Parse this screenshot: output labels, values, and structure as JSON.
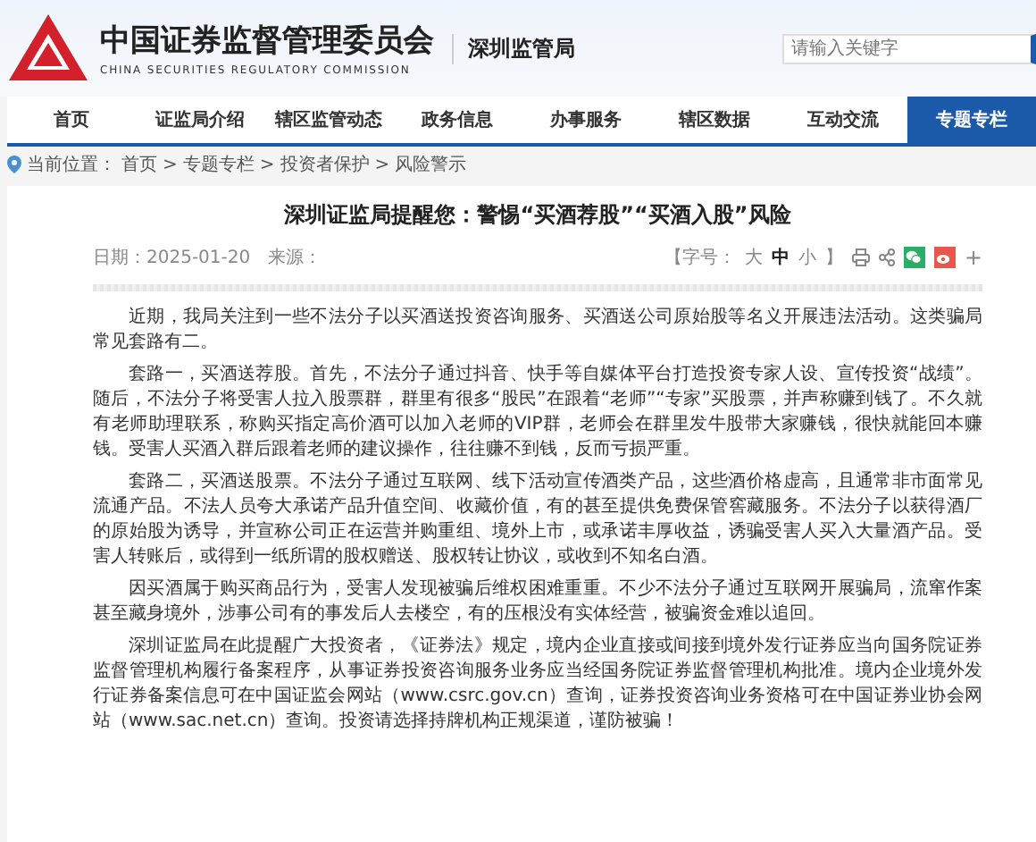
{
  "header": {
    "org_name": "中国证券监督管理委员会",
    "org_name_en": "CHINA SECURITIES REGULATORY COMMISSION",
    "bureau": "深圳监管局",
    "search": {
      "placeholder": "请输入关键字"
    }
  },
  "nav": [
    {
      "label": "首页",
      "selected": false
    },
    {
      "label": "证监局介绍",
      "selected": false
    },
    {
      "label": "辖区监管动态",
      "selected": false
    },
    {
      "label": "政务信息",
      "selected": false
    },
    {
      "label": "办事服务",
      "selected": false
    },
    {
      "label": "辖区数据",
      "selected": false
    },
    {
      "label": "互动交流",
      "selected": false
    },
    {
      "label": "专题专栏",
      "selected": true
    }
  ],
  "breadcrumb": {
    "label": "当前位置：",
    "items": [
      "首页",
      "专题专栏",
      "投资者保护",
      "风险警示"
    ],
    "separator": ">"
  },
  "article": {
    "title": "深圳证监局提醒您：警惕“买酒荐股”“买酒入股”风险",
    "date": "日期：2025-01-20",
    "source": "来源：",
    "font_size": {
      "label": "【字号：",
      "options": [
        {
          "label": "大",
          "selected": false
        },
        {
          "label": "中",
          "selected": true
        },
        {
          "label": "小",
          "selected": false
        }
      ],
      "close": "】"
    },
    "more": "+",
    "paragraphs": [
      "近期，我局关注到一些不法分子以买酒送投资咨询服务、买酒送公司原始股等名义开展违法活动。这类骗局常见套路有二。",
      "套路一，买酒送荐股。首先，不法分子通过抖音、快手等自媒体平台打造投资专家人设、宣传投资“战绩”。随后，不法分子将受害人拉入股票群，群里有很多“股民”在跟着“老师”“专家”买股票，并声称赚到钱了。不久就有老师助理联系，称购买指定高价酒可以加入老师的VIP群，老师会在群里发牛股带大家赚钱，很快就能回本赚钱。受害人买酒入群后跟着老师的建议操作，往往赚不到钱，反而亏损严重。",
      "套路二，买酒送股票。不法分子通过互联网、线下活动宣传酒类产品，这些酒价格虚高，且通常非市面常见流通产品。不法人员夸大承诺产品升值空间、收藏价值，有的甚至提供免费保管窖藏服务。不法分子以获得酒厂的原始股为诱导，并宣称公司正在运营并购重组、境外上市，或承诺丰厚收益，诱骗受害人买入大量酒产品。受害人转账后，或得到一纸所谓的股权赠送、股权转让协议，或收到不知名白酒。",
      "因买酒属于购买商品行为，受害人发现被骗后维权困难重重。不少不法分子通过互联网开展骗局，流窜作案甚至藏身境外，涉事公司有的事发后人去楼空，有的压根没有实体经营，被骗资金难以追回。",
      "深圳证监局在此提醒广大投资者，《证券法》规定，境内企业直接或间接到境外发行证券应当向国务院证券监督管理机构履行备案程序，从事证券投资咨询服务业务应当经国务院证券监督管理机构批准。境内企业境外发行证券备案信息可在中国证监会网站（www.csrc.gov.cn）查询，证券投资咨询业务资格可在中国证券业协会网站（www.sac.net.cn）查询。投资请选择持牌机构正规渠道，谨防被骗！"
    ]
  }
}
